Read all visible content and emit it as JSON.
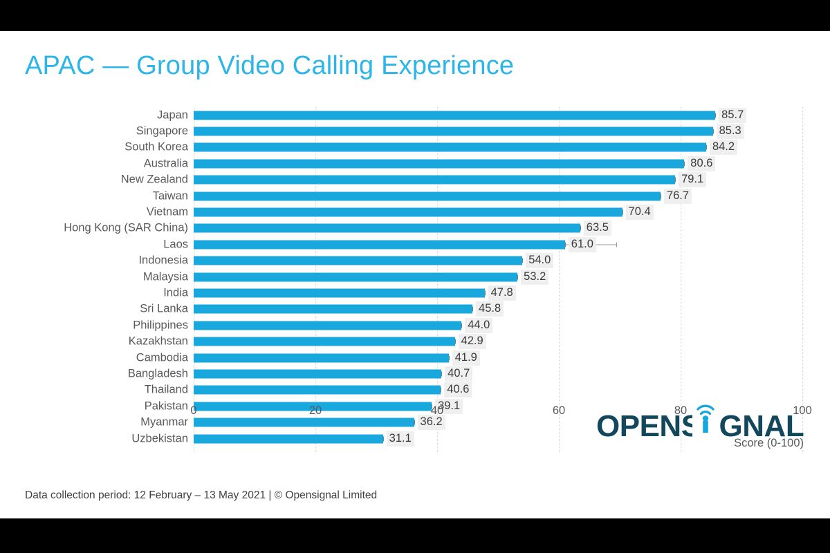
{
  "slide": {
    "title": "APAC — Group Video Calling Experience",
    "footer_note": "Data collection period: 12 February – 13 May 2021  |  © Opensignal Limited",
    "logo": {
      "word_before": "OPENS",
      "word_after": "GNAL",
      "i_icon": "signal-tower-icon",
      "brand_color": "#12475C",
      "accent_color": "#19A8DE"
    }
  },
  "chart_data": {
    "type": "bar",
    "orientation": "horizontal",
    "title": "APAC — Group Video Calling Experience",
    "subtitle": "",
    "xlabel": "Score (0-100)",
    "ylabel": "",
    "xlim": [
      0,
      100
    ],
    "xticks": [
      0,
      20,
      40,
      60,
      80,
      100
    ],
    "xtick_labels": [
      "0",
      "20",
      "40",
      "60",
      "80",
      "100"
    ],
    "grid": "vertical-dotted",
    "legend": "none",
    "bar_color": "#19A8DE",
    "title_color": "#2BB5E8",
    "categories": [
      "Japan",
      "Singapore",
      "South Korea",
      "Australia",
      "New Zealand",
      "Taiwan",
      "Vietnam",
      "Hong Kong (SAR China)",
      "Laos",
      "Indonesia",
      "Malaysia",
      "India",
      "Sri Lanka",
      "Philippines",
      "Kazakhstan",
      "Cambodia",
      "Bangladesh",
      "Thailand",
      "Pakistan",
      "Myanmar",
      "Uzbekistan"
    ],
    "values": [
      85.7,
      85.3,
      84.2,
      80.6,
      79.1,
      76.7,
      70.4,
      63.5,
      61.0,
      54.0,
      53.2,
      47.8,
      45.8,
      44.0,
      42.9,
      41.9,
      40.7,
      40.6,
      39.1,
      36.2,
      31.1
    ],
    "value_labels": [
      "85.7",
      "85.3",
      "84.2",
      "80.6",
      "79.1",
      "76.7",
      "70.4",
      "63.5",
      "61.0",
      "54.0",
      "53.2",
      "47.8",
      "45.8",
      "44.0",
      "42.9",
      "41.9",
      "40.7",
      "40.6",
      "39.1",
      "36.2",
      "31.1"
    ],
    "error_bars": [
      {
        "category": "Laos",
        "upper": 69.4
      }
    ]
  }
}
